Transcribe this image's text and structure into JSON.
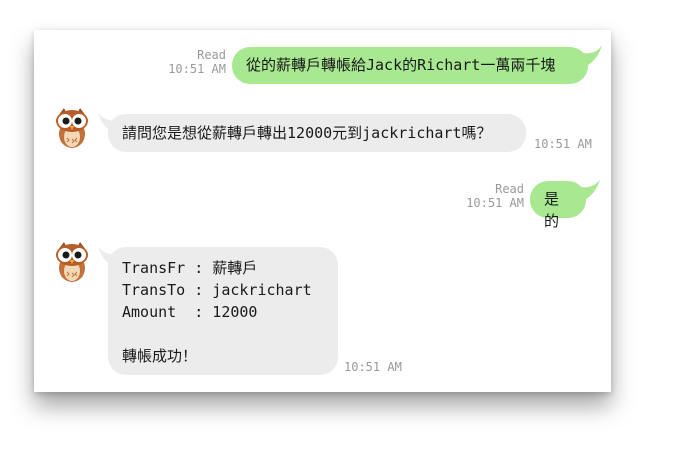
{
  "messages": [
    {
      "direction": "out",
      "status": "Read",
      "time": "10:51 AM",
      "text": "從的薪轉戶轉帳給Jack的Richart一萬兩千塊"
    },
    {
      "direction": "in",
      "time": "10:51 AM",
      "text": "請問您是想從薪轉戶轉出12000元到jackrichart嗎？",
      "avatar_icon": "owl-icon"
    },
    {
      "direction": "out",
      "status": "Read",
      "time": "10:51 AM",
      "text": "是的"
    },
    {
      "direction": "in",
      "time": "10:51 AM",
      "avatar_icon": "owl-icon",
      "lines": [
        "TransFr : 薪轉戶",
        "TransTo : jackrichart",
        "Amount  : 12000",
        "",
        "轉帳成功！"
      ]
    }
  ],
  "colors": {
    "outgoing_bubble": "#a8e890",
    "incoming_bubble": "#ececec",
    "meta_text": "#9a9a9a"
  }
}
